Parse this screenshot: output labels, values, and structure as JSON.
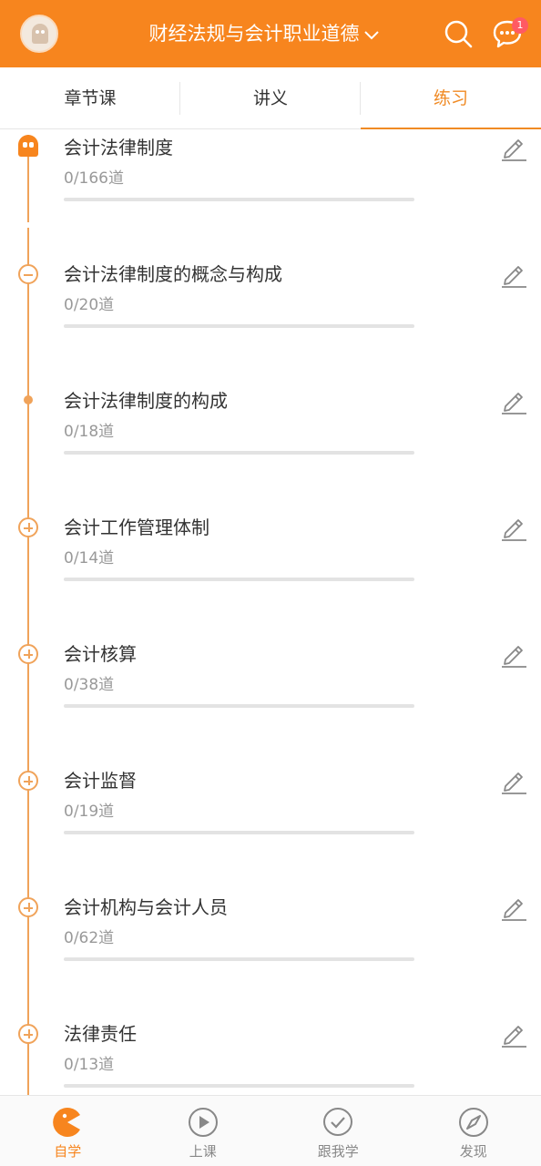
{
  "header": {
    "title": "财经法规与会计职业道德",
    "message_badge": "1"
  },
  "tabs": [
    {
      "label": "章节课",
      "active": false
    },
    {
      "label": "讲义",
      "active": false
    },
    {
      "label": "练习",
      "active": true
    }
  ],
  "chapters": [
    {
      "name": "会计法律制度",
      "count": "0/166道",
      "progress": 0,
      "marker": "ghost"
    },
    {
      "name": "会计法律制度的概念与构成",
      "count": "0/20道",
      "progress": 0,
      "marker": "minus"
    },
    {
      "name": "会计法律制度的构成",
      "count": "0/18道",
      "progress": 0,
      "marker": "dot"
    },
    {
      "name": "会计工作管理体制",
      "count": "0/14道",
      "progress": 0,
      "marker": "plus"
    },
    {
      "name": "会计核算",
      "count": "0/38道",
      "progress": 0,
      "marker": "plus"
    },
    {
      "name": "会计监督",
      "count": "0/19道",
      "progress": 0,
      "marker": "plus"
    },
    {
      "name": "会计机构与会计人员",
      "count": "0/62道",
      "progress": 0,
      "marker": "plus"
    },
    {
      "name": "法律责任",
      "count": "0/13道",
      "progress": 0,
      "marker": "plus"
    }
  ],
  "bottom_nav": [
    {
      "label": "自学",
      "icon": "pacman-icon",
      "active": true
    },
    {
      "label": "上课",
      "icon": "play-icon",
      "active": false
    },
    {
      "label": "跟我学",
      "icon": "check-circle-icon",
      "active": false
    },
    {
      "label": "发现",
      "icon": "compass-icon",
      "active": false
    }
  ],
  "colors": {
    "accent": "#f7851e",
    "timeline": "#f0a35a"
  }
}
